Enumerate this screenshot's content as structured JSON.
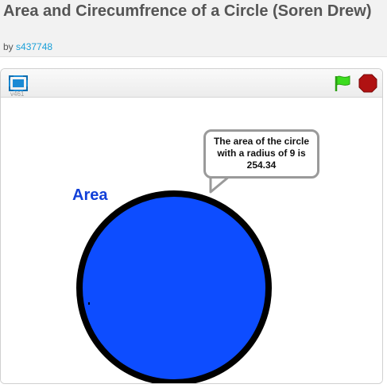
{
  "header": {
    "title": "Area and Cirecumfrence of a Circle (Soren Drew)",
    "by_prefix": "by",
    "author": "s437748"
  },
  "player": {
    "version": "v461",
    "icons": {
      "fullscreen": "fullscreen-icon",
      "green_flag": "green-flag-icon",
      "stop": "stop-icon"
    }
  },
  "stage": {
    "sprite_label": "Area",
    "speech_bubble": "The area of the circle with a radius of 9 is 254.34",
    "colors": {
      "circle_fill": "#0d4dff",
      "circle_stroke": "#000000",
      "label": "#1240d8",
      "flag": "#3cdc1e",
      "stop": "#b01212"
    }
  }
}
